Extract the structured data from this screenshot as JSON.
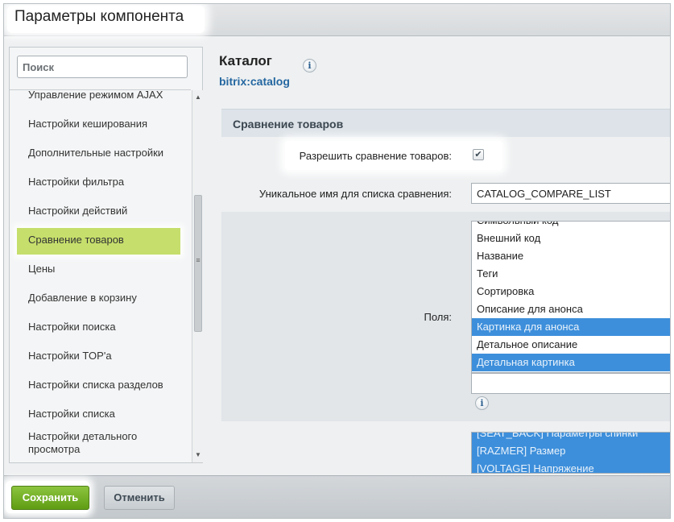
{
  "window": {
    "title": "Параметры компонента"
  },
  "sidebar": {
    "search_placeholder": "Поиск",
    "items": [
      {
        "label": "Управление режимом AJAX"
      },
      {
        "label": "Настройки кеширования"
      },
      {
        "label": "Дополнительные настройки"
      },
      {
        "label": "Настройки фильтра"
      },
      {
        "label": "Настройки действий"
      },
      {
        "label": "Сравнение товаров",
        "active": true
      },
      {
        "label": "Цены"
      },
      {
        "label": "Добавление в корзину"
      },
      {
        "label": "Настройки поиска"
      },
      {
        "label": "Настройки TOP'а"
      },
      {
        "label": "Настройки списка разделов"
      },
      {
        "label": "Настройки списка"
      },
      {
        "label": "Настройки детального просмотра"
      }
    ],
    "scrollbar": {
      "up_icon": "▲",
      "down_icon": "▼",
      "grip_icon": "≡"
    }
  },
  "component": {
    "name": "Каталог",
    "code": "bitrix:catalog",
    "info_icon": "i"
  },
  "section": {
    "title": "Сравнение товаров",
    "allow_compare_label": "Разрешить сравнение товаров:",
    "allow_compare_checked": true,
    "checkmark": "✔",
    "compare_name_label": "Уникальное имя для списка сравнения:",
    "compare_name_value": "CATALOG_COMPARE_LIST",
    "fields_label": "Поля:",
    "fields_options": [
      {
        "label": "Символьный код",
        "selected": false
      },
      {
        "label": "Внешний код",
        "selected": false
      },
      {
        "label": "Название",
        "selected": false
      },
      {
        "label": "Теги",
        "selected": false
      },
      {
        "label": "Сортировка",
        "selected": false
      },
      {
        "label": "Описание для анонса",
        "selected": false
      },
      {
        "label": "Картинка для анонса",
        "selected": true
      },
      {
        "label": "Детальное описание",
        "selected": false
      },
      {
        "label": "Детальная картинка",
        "selected": true
      }
    ],
    "properties_options": [
      {
        "label": "[SEAT_BACK] Параметры спинки"
      },
      {
        "label": "[RAZMER] Размер"
      },
      {
        "label": "[VOLTAGE] Напряжение"
      }
    ]
  },
  "footer": {
    "save_label": "Сохранить",
    "cancel_label": "Отменить"
  },
  "colors": {
    "save_button": "#6aa81c",
    "active_menu": "#c6df6c",
    "selected_option": "#3d8fdb",
    "link": "#2567a1"
  }
}
